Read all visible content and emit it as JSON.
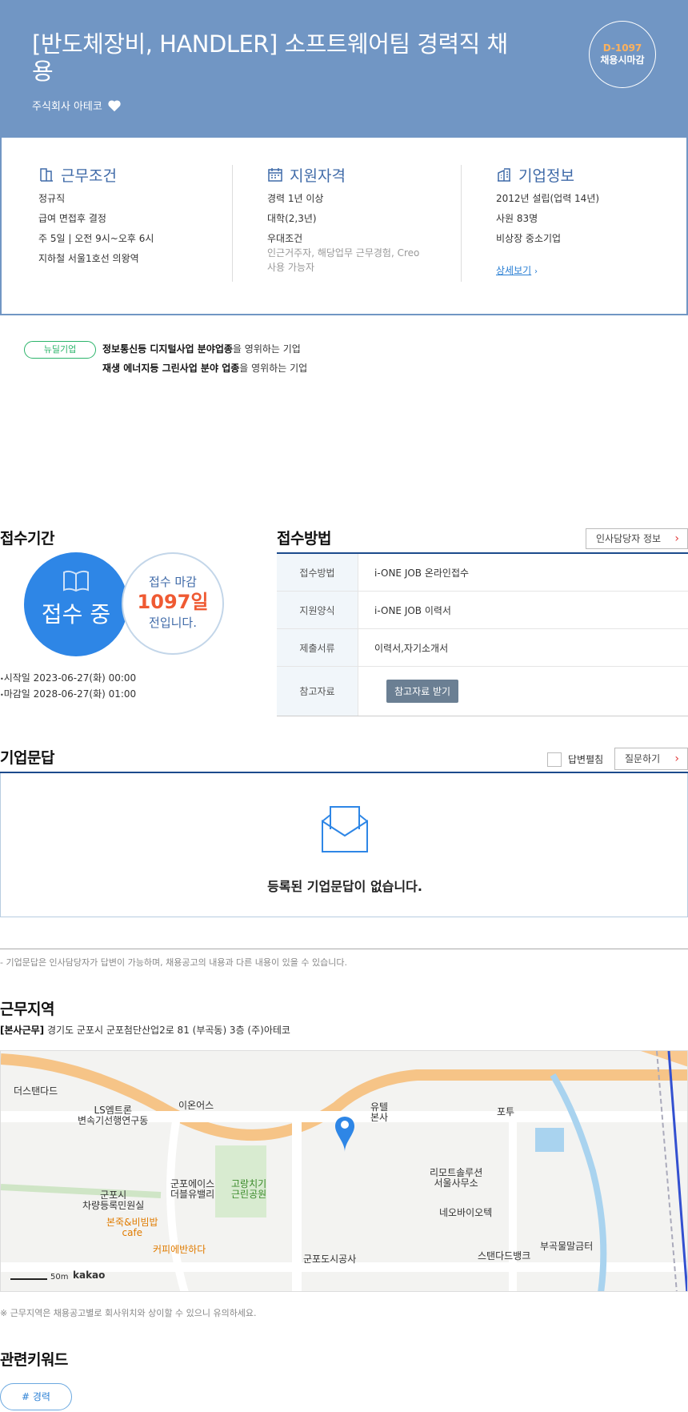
{
  "header": {
    "title": "[반도체장비, HANDLER] 소프트웨어팀 경력직 채용",
    "company": "주식회사 아테코",
    "dday": "D-1097",
    "dday_label": "채용시마감"
  },
  "info": {
    "work": {
      "title": "근무조건",
      "lines": [
        "정규직",
        "급여 면접후 결정",
        "주 5일 | 오전 9시~오후 6시",
        "지하철 서울1호선 의왕역"
      ]
    },
    "qual": {
      "title": "지원자격",
      "lines": [
        "경력 1년 이상",
        "대학(2,3년)",
        "우대조건"
      ],
      "sub": "인근거주자, 해당업무 근무경험, Creo 사용 가능자"
    },
    "corp": {
      "title": "기업정보",
      "lines": [
        "2012년 설립(업력 14년)",
        "사원 83명",
        "비상장 중소기업"
      ],
      "more": "상세보기"
    }
  },
  "newdeal": {
    "tag": "뉴딜기업",
    "line1_bold": "정보통신등 디지털사업 분야업종",
    "line1_rest": "을 영위하는 기업",
    "line2_bold": "재생 에너지등 그린사업 분야 업종",
    "line2_rest": "을 영위하는 기업"
  },
  "period": {
    "title": "접수기간",
    "status": "접수 중",
    "deadline_a": "접수 마감",
    "deadline_b": "1097일",
    "deadline_c": "전입니다.",
    "start": "시작일 2023-06-27(화) 00:00",
    "end": "마감일 2028-06-27(화) 01:00"
  },
  "method": {
    "title": "접수방법",
    "hr_button": "인사담당자 정보",
    "rows": [
      {
        "k": "접수방법",
        "v": "i-ONE JOB 온라인접수"
      },
      {
        "k": "지원양식",
        "v": "i-ONE JOB 이력서"
      },
      {
        "k": "제출서류",
        "v": "이력서,자기소개서"
      },
      {
        "k": "참고자료",
        "v": "참고자료 받기"
      }
    ]
  },
  "qa": {
    "title": "기업문답",
    "check_label": "답변펼침",
    "ask_button": "질문하기",
    "empty": "등록된 기업문답이 없습니다.",
    "note": "- 기업문답은 인사담당자가 답변이 가능하며, 채용공고의 내용과 다른 내용이 있을 수 있습니다."
  },
  "location": {
    "title": "근무지역",
    "addr_bold": "[본사근무]",
    "addr": " 경기도 군포시 군포첨단산업2로 81 (부곡동) 3층 (주)아테코",
    "note": "※ 근무지역은 채용공고별로 회사위치와 상이할 수 있으니 유의하세요.",
    "map_labels": [
      "더스탠다드",
      "LS엠트론\n변속기선행연구동",
      "이온어스",
      "유텔\n본사",
      "포투",
      "군포에이스\n더블유밸리",
      "고랑치기\n근린공원",
      "군포시\n차량등록민원실",
      "리모트솔루션\n서울사무소",
      "네오바이오텍",
      "본죽&비빔밥\ncafe",
      "커피에반하다",
      "군포도시공사",
      "부곡물말금터",
      "스탠다드뱅크"
    ],
    "scale": "50m",
    "brand": "kakao"
  },
  "keywords": {
    "title": "관련키워드",
    "items": [
      "# 경력"
    ]
  },
  "colors": {
    "header_bg": "#7196c4",
    "accent": "#2e86e6",
    "deadline": "#ef5a33",
    "newdeal": "#2bb46a"
  }
}
